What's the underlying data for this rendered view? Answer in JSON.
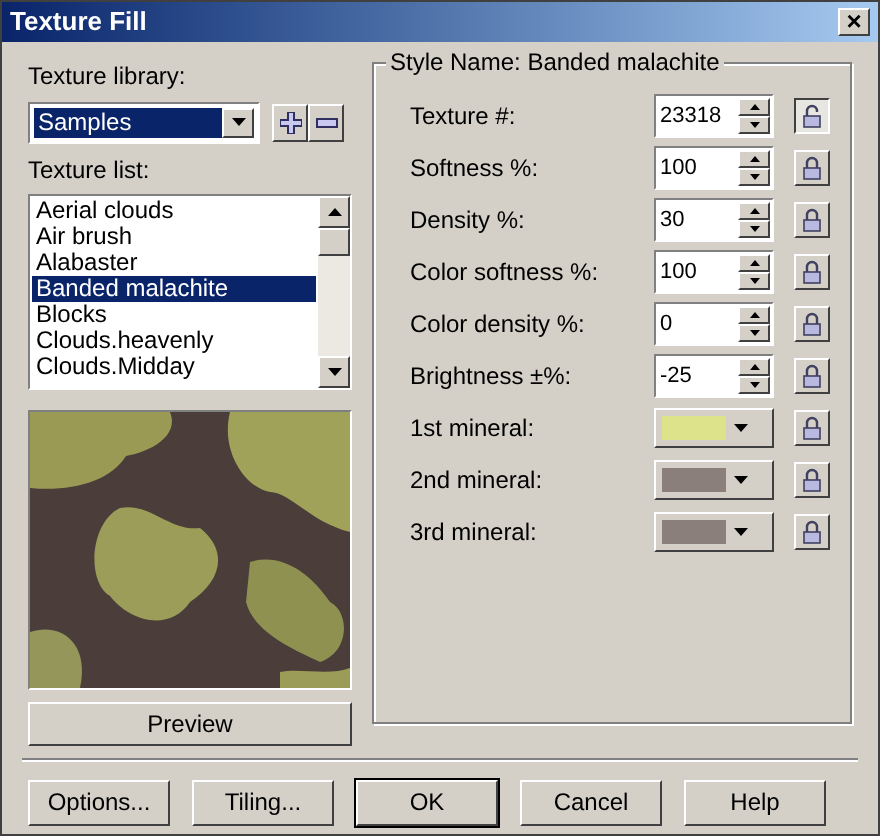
{
  "window": {
    "title": "Texture Fill",
    "close": "×"
  },
  "library": {
    "label": "Texture library:",
    "value": "Samples"
  },
  "texture_list": {
    "label": "Texture list:",
    "items": [
      {
        "label": "Aerial clouds",
        "selected": false
      },
      {
        "label": "Air brush",
        "selected": false
      },
      {
        "label": "Alabaster",
        "selected": false
      },
      {
        "label": "Banded malachite",
        "selected": true
      },
      {
        "label": "Blocks",
        "selected": false
      },
      {
        "label": "Clouds.heavenly",
        "selected": false
      },
      {
        "label": "Clouds.Midday",
        "selected": false
      }
    ]
  },
  "preview_button": "Preview",
  "style_group": {
    "title": "Style Name: Banded malachite",
    "params": [
      {
        "kind": "spin",
        "label": "Texture #:",
        "value": "23318",
        "locked": false
      },
      {
        "kind": "spin",
        "label": "Softness %:",
        "value": "100",
        "locked": true
      },
      {
        "kind": "spin",
        "label": "Density %:",
        "value": "30",
        "locked": true
      },
      {
        "kind": "spin",
        "label": "Color softness %:",
        "value": "100",
        "locked": true
      },
      {
        "kind": "spin",
        "label": "Color density %:",
        "value": "0",
        "locked": true
      },
      {
        "kind": "spin",
        "label": "Brightness ±%:",
        "value": "-25",
        "locked": true
      },
      {
        "kind": "color",
        "label": "1st mineral:",
        "color": "#dde38b",
        "locked": true
      },
      {
        "kind": "color",
        "label": "2nd mineral:",
        "color": "#8a7f7b",
        "locked": true
      },
      {
        "kind": "color",
        "label": "3rd mineral:",
        "color": "#8a7f7b",
        "locked": true
      }
    ]
  },
  "buttons": [
    {
      "label": "Options...",
      "default": false
    },
    {
      "label": "Tiling...",
      "default": false
    },
    {
      "label": "OK",
      "default": true
    },
    {
      "label": "Cancel",
      "default": false
    },
    {
      "label": "Help",
      "default": false
    }
  ]
}
